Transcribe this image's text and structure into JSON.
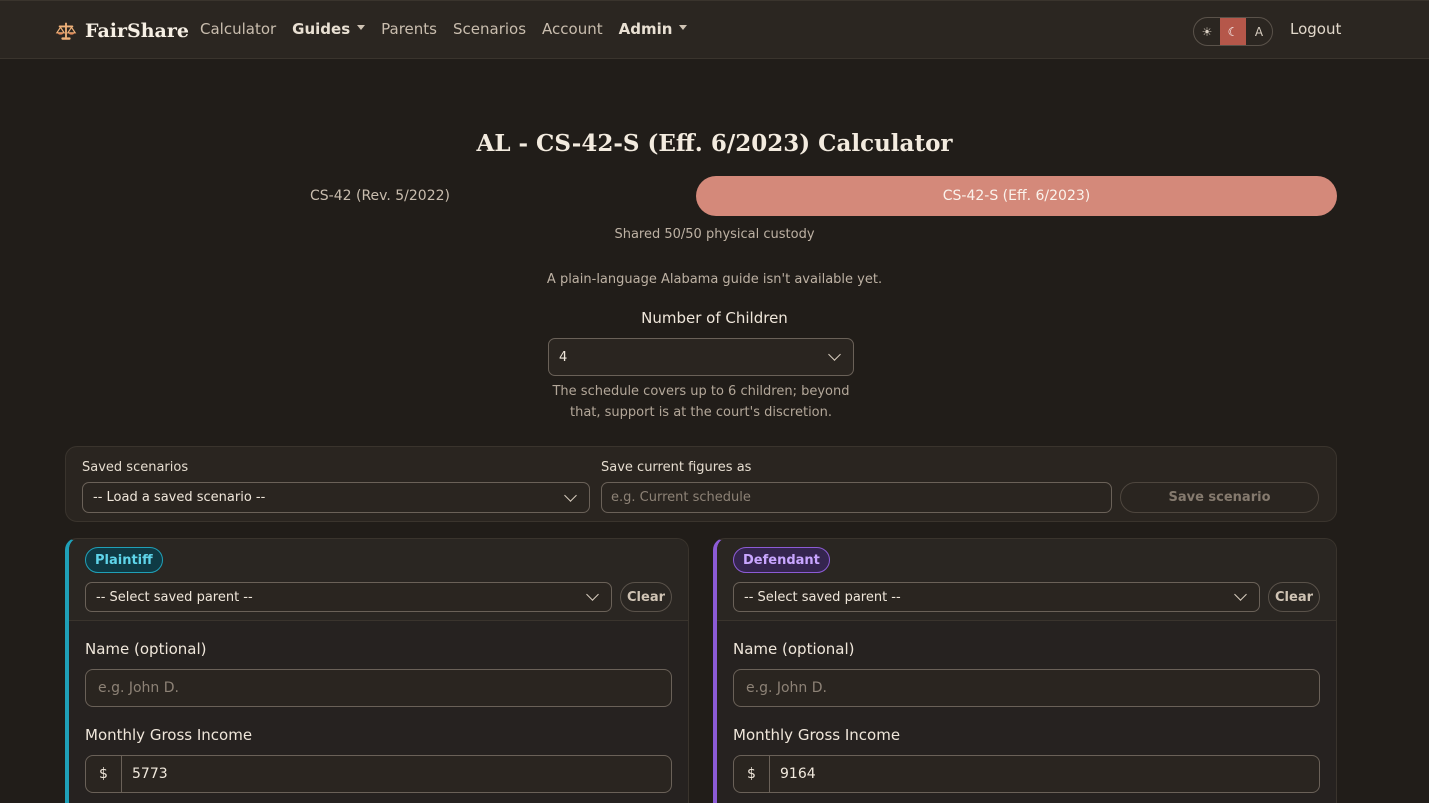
{
  "nav": {
    "brand": "FairShare",
    "items": [
      {
        "label": "Calculator",
        "bold": false,
        "dropdown": false
      },
      {
        "label": "Guides",
        "bold": true,
        "dropdown": true
      },
      {
        "label": "Parents",
        "bold": false,
        "dropdown": false
      },
      {
        "label": "Scenarios",
        "bold": false,
        "dropdown": false
      },
      {
        "label": "Account",
        "bold": false,
        "dropdown": false
      },
      {
        "label": "Admin",
        "bold": true,
        "dropdown": true
      }
    ],
    "theme": {
      "light": "☀",
      "dark": "☾",
      "auto": "A",
      "active": "dark"
    },
    "logout": "Logout"
  },
  "page": {
    "title": "AL - CS-42-S (Eff. 6/2023) Calculator",
    "tabs": [
      {
        "label": "CS-42 (Rev. 5/2022)",
        "active": false
      },
      {
        "label": "CS-42-S (Eff. 6/2023)",
        "active": true
      }
    ],
    "custody_note": "Shared 50/50 physical custody",
    "guide_note": "A plain-language Alabama guide isn't available yet.",
    "children_label": "Number of Children",
    "children_value": "4",
    "children_help_1": "The schedule covers up to 6 children; beyond",
    "children_help_2": "that, support is at the court's discretion."
  },
  "scenarios": {
    "saved_label": "Saved scenarios",
    "saved_value": "-- Load a saved scenario --",
    "save_label": "Save current figures as",
    "save_placeholder": "e.g. Current schedule",
    "save_button": "Save scenario"
  },
  "plaintiff": {
    "badge": "Plaintiff",
    "select_value": "-- Select saved parent --",
    "clear": "Clear",
    "name_label": "Name (optional)",
    "name_placeholder": "e.g. John D.",
    "income_label": "Monthly Gross Income",
    "currency": "$",
    "income_value": "5773"
  },
  "defendant": {
    "badge": "Defendant",
    "select_value": "-- Select saved parent --",
    "clear": "Clear",
    "name_label": "Name (optional)",
    "name_placeholder": "e.g. John D.",
    "income_label": "Monthly Gross Income",
    "currency": "$",
    "income_value": "9164"
  },
  "colors": {
    "accent": "#d4897a",
    "plaintiff": "#1fa0b8",
    "defendant": "#8c5bd6"
  }
}
